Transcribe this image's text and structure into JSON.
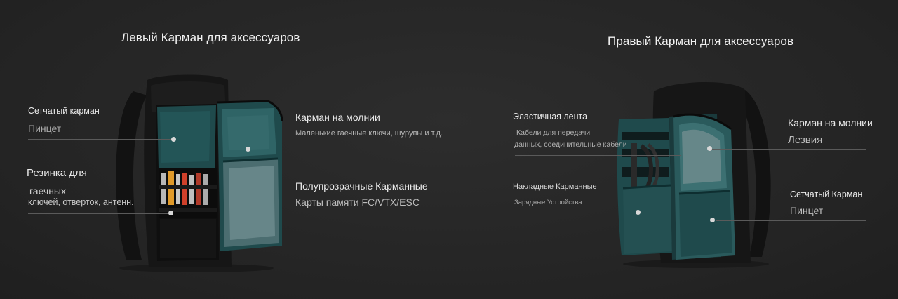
{
  "left_panel": {
    "title": "Левый Карман для аксессуаров",
    "labels": [
      {
        "heading": "Сетчатый карман",
        "detail": "Пинцет"
      },
      {
        "heading": "Резинка для",
        "detail_line1": "гаечных",
        "detail_line2": "ключей, отверток, антенн."
      },
      {
        "heading": "Карман на молнии",
        "detail": "Маленькие гаечные ключи, шурупы и т.д."
      },
      {
        "heading": "Полупрозрачные Карманные",
        "detail": "Карты памяти FC/VTX/ESC"
      }
    ]
  },
  "right_panel": {
    "title": "Правый Карман для аксессуаров",
    "labels": [
      {
        "heading": "Эластичная лента",
        "detail_line1": "Кабели для передачи",
        "detail_line2": "данных, соединительные кабели"
      },
      {
        "heading": "Накладные Карманные",
        "detail": "Зарядные Устройства"
      },
      {
        "heading": "Карман на молнии",
        "detail": "Лезвия"
      },
      {
        "heading": "Сетчатый Карман",
        "detail": "Пинцет"
      }
    ]
  },
  "colors": {
    "background": "#262626",
    "bag_black": "#151515",
    "lining_teal": "#1f4a4c",
    "lining_light": "#2f6466",
    "pointer_dot": "#d8d8d8",
    "callout_line": "#5a5a5a"
  }
}
